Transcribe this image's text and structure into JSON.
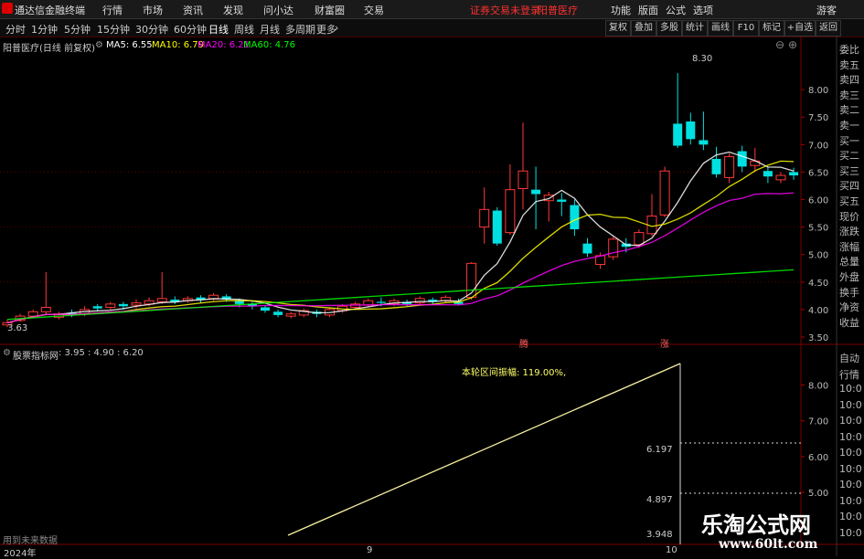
{
  "app": {
    "title": "通达信金融终端",
    "menu": [
      "行情",
      "市场",
      "资讯",
      "发现",
      "问小达",
      "财富圈",
      "交易"
    ],
    "status": "证券交易未登录",
    "stock_title": "阳普医疗",
    "right_menu": [
      "功能",
      "版面",
      "公式",
      "选项"
    ],
    "user": "游客"
  },
  "toolbar": {
    "periods": [
      "分时",
      "1分钟",
      "5分钟",
      "15分钟",
      "30分钟",
      "60分钟",
      "日线",
      "周线",
      "月线",
      "多周期",
      "更多"
    ],
    "active": "日线",
    "right_buttons": [
      "复权",
      "叠加",
      "多股",
      "统计",
      "画线",
      "F10",
      "标记",
      "+自选",
      "返回"
    ]
  },
  "main_panel": {
    "title": "阳普医疗(日线 前复权)",
    "ma": [
      {
        "label": "MA5: 6.55",
        "color": "#ffffff"
      },
      {
        "label": "MA10: 6.79",
        "color": "#ffff00"
      },
      {
        "label": "MA20: 6.21",
        "color": "#ff00ff"
      },
      {
        "label": "MA60: 4.76",
        "color": "#00ff00"
      }
    ],
    "y_ticks": [
      "8.00",
      "7.50",
      "7.00",
      "6.50",
      "6.00",
      "5.50",
      "5.00",
      "4.50",
      "4.00",
      "3.50"
    ],
    "high_label": "8.30",
    "low_label": "3.63",
    "markers": [
      "腾",
      "涨"
    ]
  },
  "indicator_panel": {
    "title": "股票指标网",
    "values": ": 3.95 : 4.90 : 6.20",
    "annotation": "本轮区间振幅: 119.00%,",
    "labels": [
      "6.197",
      "4.897",
      "3.948"
    ],
    "y_ticks": [
      "8.00",
      "7.00",
      "6.00",
      "5.00"
    ],
    "footer": "用到未来数据"
  },
  "x_axis": [
    "2024年",
    "9",
    "10"
  ],
  "right_sidebar": {
    "top": [
      "委比",
      "卖五",
      "卖四",
      "卖三",
      "卖二",
      "卖一",
      "买一",
      "买二",
      "买三",
      "买四",
      "买五",
      "现价",
      "涨跌",
      "涨幅",
      "总量",
      "外盘",
      "换手",
      "净资",
      "收益"
    ],
    "bottom": [
      "自动",
      "行情",
      "10:0",
      "10:0",
      "10:0",
      "10:0",
      "10:0",
      "10:0",
      "10:0",
      "10:0",
      "10:0",
      "10:0"
    ]
  },
  "watermark": {
    "title": "乐淘公式网",
    "url": "www.60lt.com"
  },
  "chart_data": {
    "type": "candlestick",
    "price_range": [
      3.4,
      8.6
    ],
    "candles": [
      [
        3.72,
        3.76,
        3.68,
        3.82
      ],
      [
        3.8,
        3.88,
        3.78,
        3.92
      ],
      [
        3.88,
        3.96,
        3.84,
        4.0
      ],
      [
        3.96,
        4.04,
        3.92,
        4.68
      ],
      [
        3.86,
        3.92,
        3.82,
        3.96
      ],
      [
        3.94,
        3.9,
        3.86,
        4.0
      ],
      [
        3.92,
        4.0,
        3.88,
        4.06
      ],
      [
        4.06,
        4.02,
        3.96,
        4.1
      ],
      [
        4.04,
        4.1,
        4.0,
        4.14
      ],
      [
        4.1,
        4.06,
        4.0,
        4.14
      ],
      [
        4.08,
        4.12,
        4.02,
        4.18
      ],
      [
        4.1,
        4.16,
        4.06,
        4.22
      ],
      [
        4.14,
        4.2,
        4.1,
        4.68
      ],
      [
        4.18,
        4.14,
        4.1,
        4.24
      ],
      [
        4.16,
        4.2,
        4.12,
        4.24
      ],
      [
        4.22,
        4.18,
        4.12,
        4.26
      ],
      [
        4.2,
        4.26,
        4.16,
        4.3
      ],
      [
        4.24,
        4.18,
        4.14,
        4.28
      ],
      [
        4.16,
        4.1,
        4.04,
        4.2
      ],
      [
        4.1,
        4.06,
        4.0,
        4.14
      ],
      [
        4.04,
        3.98,
        3.94,
        4.08
      ],
      [
        3.96,
        3.9,
        3.86,
        4.0
      ],
      [
        3.88,
        3.92,
        3.84,
        3.96
      ],
      [
        3.9,
        3.98,
        3.86,
        4.02
      ],
      [
        3.96,
        3.92,
        3.86,
        4.0
      ],
      [
        3.9,
        4.0,
        3.86,
        4.04
      ],
      [
        3.98,
        4.06,
        3.94,
        4.1
      ],
      [
        4.04,
        4.1,
        4.0,
        4.14
      ],
      [
        4.08,
        4.16,
        4.04,
        4.2
      ],
      [
        4.14,
        4.12,
        4.06,
        4.22
      ],
      [
        4.1,
        4.16,
        4.06,
        4.2
      ],
      [
        4.14,
        4.1,
        4.06,
        4.18
      ],
      [
        4.12,
        4.2,
        4.08,
        4.24
      ],
      [
        4.18,
        4.14,
        4.1,
        4.22
      ],
      [
        4.16,
        4.22,
        4.12,
        4.26
      ],
      [
        4.14,
        4.1,
        4.08,
        4.2
      ],
      [
        4.22,
        4.84,
        4.18,
        4.86
      ],
      [
        5.5,
        5.82,
        5.2,
        6.22
      ],
      [
        5.8,
        5.2,
        5.16,
        5.86
      ],
      [
        5.4,
        6.18,
        5.36,
        6.64
      ],
      [
        6.2,
        6.52,
        5.82,
        7.4
      ],
      [
        6.18,
        6.1,
        5.46,
        6.6
      ],
      [
        5.98,
        6.08,
        5.6,
        6.14
      ],
      [
        6.0,
        5.96,
        5.7,
        6.12
      ],
      [
        5.9,
        5.46,
        5.34,
        6.0
      ],
      [
        5.2,
        5.02,
        4.96,
        5.3
      ],
      [
        4.82,
        4.98,
        4.74,
        5.04
      ],
      [
        4.96,
        5.28,
        4.9,
        5.34
      ],
      [
        5.2,
        5.14,
        5.04,
        5.3
      ],
      [
        5.18,
        5.4,
        5.12,
        5.46
      ],
      [
        5.38,
        5.7,
        5.34,
        6.1
      ],
      [
        5.72,
        6.52,
        5.68,
        6.6
      ],
      [
        7.38,
        6.98,
        6.94,
        8.3
      ],
      [
        7.42,
        7.1,
        7.0,
        7.58
      ],
      [
        7.08,
        7.0,
        6.9,
        7.6
      ],
      [
        6.74,
        6.46,
        6.4,
        6.96
      ],
      [
        6.4,
        6.78,
        6.3,
        6.84
      ],
      [
        6.88,
        6.6,
        6.5,
        6.98
      ],
      [
        6.62,
        6.7,
        6.5,
        6.94
      ],
      [
        6.52,
        6.42,
        6.3,
        6.6
      ],
      [
        6.36,
        6.44,
        6.3,
        6.5
      ],
      [
        6.5,
        6.44,
        6.36,
        6.58
      ]
    ],
    "indicator": {
      "low": 3.948,
      "mid": 4.897,
      "high": 6.197,
      "range": [
        3.7,
        8.6
      ]
    }
  }
}
